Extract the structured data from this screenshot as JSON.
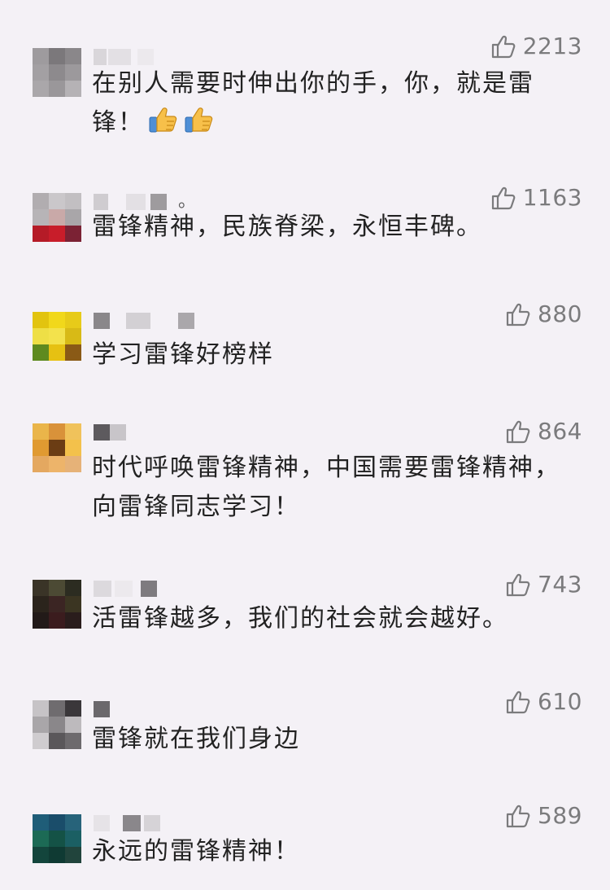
{
  "comments": [
    {
      "likes": "2213",
      "text": "在别人需要时伸出你的手，你，就是雷锋！",
      "emoji_count": 2,
      "name_suffix": "",
      "avatar": [
        "#9e9b9e",
        "#7b787b",
        "#8a878a",
        "#a3a0a3",
        "#8d8a8d",
        "#9c999c",
        "#aaa7aa",
        "#9a979a",
        "#b5b2b5"
      ],
      "name_blocks": [
        "#d9d6da",
        "#e3e0e4",
        "#ece9ed"
      ]
    },
    {
      "likes": "1163",
      "text": "雷锋精神，民族脊梁，永恒丰碑。",
      "emoji_count": 0,
      "name_suffix": "。",
      "avatar": [
        "#b1adb0",
        "#cac7ca",
        "#c2bfc2",
        "#b7b4b7",
        "#c9a9a8",
        "#a9a6a9",
        "#b51b27",
        "#c81d2a",
        "#7b2234"
      ],
      "name_blocks": [
        "#cfccd0",
        "#e3e0e4",
        "#9e9b9e"
      ]
    },
    {
      "likes": "880",
      "text": "学习雷锋好榜样",
      "emoji_count": 0,
      "name_suffix": "",
      "avatar": [
        "#e2c40f",
        "#f1d81b",
        "#e7cb19",
        "#eedf46",
        "#f3e24c",
        "#d8ba16",
        "#5e8a1f",
        "#e6c112",
        "#8a5a16"
      ],
      "name_blocks": [
        "#8a878a",
        "#d3d0d4",
        "#aaa7ab"
      ]
    },
    {
      "likes": "864",
      "text": "时代呼唤雷锋精神，中国需要雷锋精神，向雷锋同志学习！",
      "emoji_count": 0,
      "name_suffix": "",
      "avatar": [
        "#eab54a",
        "#d9923a",
        "#f0c25b",
        "#e09a31",
        "#6b3d14",
        "#f3c14b",
        "#e4a860",
        "#edb46a",
        "#e6b278"
      ],
      "name_blocks": [
        "#5d5a5e",
        "#c8c5c9"
      ]
    },
    {
      "likes": "743",
      "text": "活雷锋越多，我们的社会就会越好。",
      "emoji_count": 0,
      "name_suffix": "",
      "avatar": [
        "#3a3427",
        "#4c4a34",
        "#2c2c21",
        "#2b241c",
        "#3b2523",
        "#3b3522",
        "#221a18",
        "#3b1c1e",
        "#2a1d1c"
      ],
      "name_blocks": [
        "#dcd9dd",
        "#ece9ed",
        "#7e7b7f"
      ]
    },
    {
      "likes": "610",
      "text": "雷锋就在我们身边",
      "emoji_count": 0,
      "name_suffix": "",
      "avatar": [
        "#c6c3c6",
        "#6f6c6f",
        "#3a373a",
        "#a9a6a9",
        "#8a878a",
        "#bdbabd",
        "#cfcccf",
        "#5a575a",
        "#6d6a6d"
      ],
      "name_blocks": [
        "#6b686c"
      ]
    },
    {
      "likes": "589",
      "text": "永远的雷锋精神！",
      "emoji_count": 0,
      "name_suffix": "",
      "avatar": [
        "#1f5d78",
        "#1a4d6a",
        "#27637a",
        "#1c6a55",
        "#145246",
        "#1b5f63",
        "#13453c",
        "#0f3a33",
        "#21443c"
      ],
      "name_blocks": [
        "#e6e3e7",
        "#8a878b",
        "#d6d3d7"
      ]
    }
  ],
  "colors": {
    "background": "#f4f1f6",
    "text": "#222222",
    "likes": "#7b7b7d"
  },
  "icons": {
    "like": "thumbs-up-outline-icon",
    "emoji": "thumbs-up-emoji-icon"
  }
}
